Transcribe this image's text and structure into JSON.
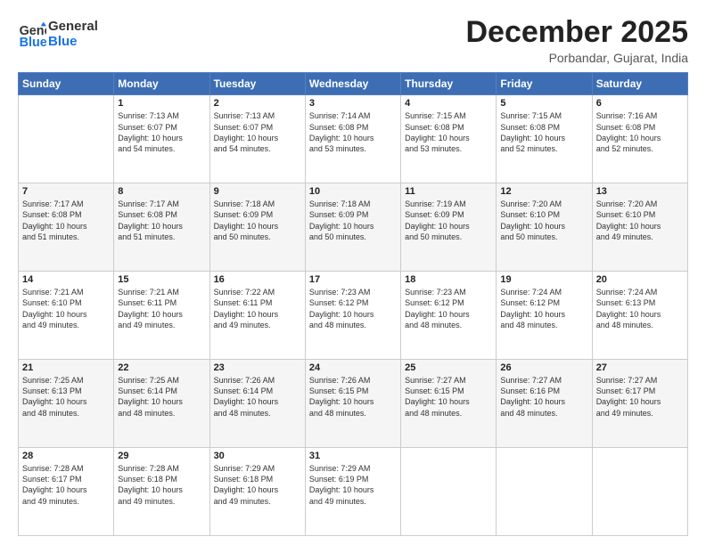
{
  "logo": {
    "line1": "General",
    "line2": "Blue"
  },
  "title": "December 2025",
  "location": "Porbandar, Gujarat, India",
  "weekdays": [
    "Sunday",
    "Monday",
    "Tuesday",
    "Wednesday",
    "Thursday",
    "Friday",
    "Saturday"
  ],
  "weeks": [
    [
      {
        "day": "",
        "info": ""
      },
      {
        "day": "1",
        "info": "Sunrise: 7:13 AM\nSunset: 6:07 PM\nDaylight: 10 hours\nand 54 minutes."
      },
      {
        "day": "2",
        "info": "Sunrise: 7:13 AM\nSunset: 6:07 PM\nDaylight: 10 hours\nand 54 minutes."
      },
      {
        "day": "3",
        "info": "Sunrise: 7:14 AM\nSunset: 6:08 PM\nDaylight: 10 hours\nand 53 minutes."
      },
      {
        "day": "4",
        "info": "Sunrise: 7:15 AM\nSunset: 6:08 PM\nDaylight: 10 hours\nand 53 minutes."
      },
      {
        "day": "5",
        "info": "Sunrise: 7:15 AM\nSunset: 6:08 PM\nDaylight: 10 hours\nand 52 minutes."
      },
      {
        "day": "6",
        "info": "Sunrise: 7:16 AM\nSunset: 6:08 PM\nDaylight: 10 hours\nand 52 minutes."
      }
    ],
    [
      {
        "day": "7",
        "info": "Sunrise: 7:17 AM\nSunset: 6:08 PM\nDaylight: 10 hours\nand 51 minutes."
      },
      {
        "day": "8",
        "info": "Sunrise: 7:17 AM\nSunset: 6:08 PM\nDaylight: 10 hours\nand 51 minutes."
      },
      {
        "day": "9",
        "info": "Sunrise: 7:18 AM\nSunset: 6:09 PM\nDaylight: 10 hours\nand 50 minutes."
      },
      {
        "day": "10",
        "info": "Sunrise: 7:18 AM\nSunset: 6:09 PM\nDaylight: 10 hours\nand 50 minutes."
      },
      {
        "day": "11",
        "info": "Sunrise: 7:19 AM\nSunset: 6:09 PM\nDaylight: 10 hours\nand 50 minutes."
      },
      {
        "day": "12",
        "info": "Sunrise: 7:20 AM\nSunset: 6:10 PM\nDaylight: 10 hours\nand 50 minutes."
      },
      {
        "day": "13",
        "info": "Sunrise: 7:20 AM\nSunset: 6:10 PM\nDaylight: 10 hours\nand 49 minutes."
      }
    ],
    [
      {
        "day": "14",
        "info": "Sunrise: 7:21 AM\nSunset: 6:10 PM\nDaylight: 10 hours\nand 49 minutes."
      },
      {
        "day": "15",
        "info": "Sunrise: 7:21 AM\nSunset: 6:11 PM\nDaylight: 10 hours\nand 49 minutes."
      },
      {
        "day": "16",
        "info": "Sunrise: 7:22 AM\nSunset: 6:11 PM\nDaylight: 10 hours\nand 49 minutes."
      },
      {
        "day": "17",
        "info": "Sunrise: 7:23 AM\nSunset: 6:12 PM\nDaylight: 10 hours\nand 48 minutes."
      },
      {
        "day": "18",
        "info": "Sunrise: 7:23 AM\nSunset: 6:12 PM\nDaylight: 10 hours\nand 48 minutes."
      },
      {
        "day": "19",
        "info": "Sunrise: 7:24 AM\nSunset: 6:12 PM\nDaylight: 10 hours\nand 48 minutes."
      },
      {
        "day": "20",
        "info": "Sunrise: 7:24 AM\nSunset: 6:13 PM\nDaylight: 10 hours\nand 48 minutes."
      }
    ],
    [
      {
        "day": "21",
        "info": "Sunrise: 7:25 AM\nSunset: 6:13 PM\nDaylight: 10 hours\nand 48 minutes."
      },
      {
        "day": "22",
        "info": "Sunrise: 7:25 AM\nSunset: 6:14 PM\nDaylight: 10 hours\nand 48 minutes."
      },
      {
        "day": "23",
        "info": "Sunrise: 7:26 AM\nSunset: 6:14 PM\nDaylight: 10 hours\nand 48 minutes."
      },
      {
        "day": "24",
        "info": "Sunrise: 7:26 AM\nSunset: 6:15 PM\nDaylight: 10 hours\nand 48 minutes."
      },
      {
        "day": "25",
        "info": "Sunrise: 7:27 AM\nSunset: 6:15 PM\nDaylight: 10 hours\nand 48 minutes."
      },
      {
        "day": "26",
        "info": "Sunrise: 7:27 AM\nSunset: 6:16 PM\nDaylight: 10 hours\nand 48 minutes."
      },
      {
        "day": "27",
        "info": "Sunrise: 7:27 AM\nSunset: 6:17 PM\nDaylight: 10 hours\nand 49 minutes."
      }
    ],
    [
      {
        "day": "28",
        "info": "Sunrise: 7:28 AM\nSunset: 6:17 PM\nDaylight: 10 hours\nand 49 minutes."
      },
      {
        "day": "29",
        "info": "Sunrise: 7:28 AM\nSunset: 6:18 PM\nDaylight: 10 hours\nand 49 minutes."
      },
      {
        "day": "30",
        "info": "Sunrise: 7:29 AM\nSunset: 6:18 PM\nDaylight: 10 hours\nand 49 minutes."
      },
      {
        "day": "31",
        "info": "Sunrise: 7:29 AM\nSunset: 6:19 PM\nDaylight: 10 hours\nand 49 minutes."
      },
      {
        "day": "",
        "info": ""
      },
      {
        "day": "",
        "info": ""
      },
      {
        "day": "",
        "info": ""
      }
    ]
  ]
}
